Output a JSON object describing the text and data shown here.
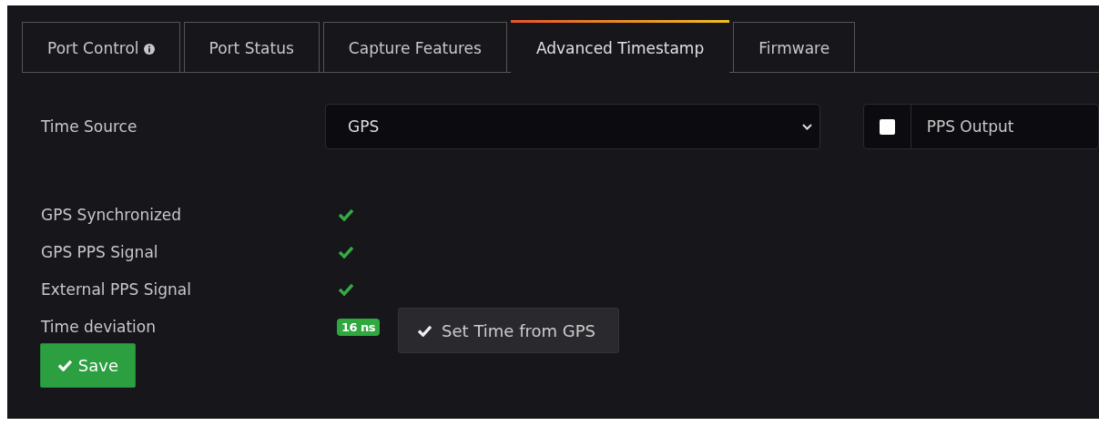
{
  "tabs": [
    {
      "label": "Port Control",
      "info": true,
      "selected": false
    },
    {
      "label": "Port Status",
      "info": false,
      "selected": false
    },
    {
      "label": "Capture Features",
      "info": false,
      "selected": false
    },
    {
      "label": "Advanced Timestamp",
      "info": false,
      "selected": true
    },
    {
      "label": "Firmware",
      "info": false,
      "selected": false
    }
  ],
  "time_source": {
    "label": "Time Source",
    "value": "GPS"
  },
  "pps_output": {
    "label": "PPS Output",
    "checked": false
  },
  "status": [
    {
      "label": "GPS Synchronized",
      "ok": true
    },
    {
      "label": "GPS PPS Signal",
      "ok": true
    },
    {
      "label": "External PPS Signal",
      "ok": true
    }
  ],
  "time_deviation": {
    "label": "Time deviation",
    "badge": "16 ns",
    "button": "Set Time from GPS"
  },
  "save_button": "Save"
}
